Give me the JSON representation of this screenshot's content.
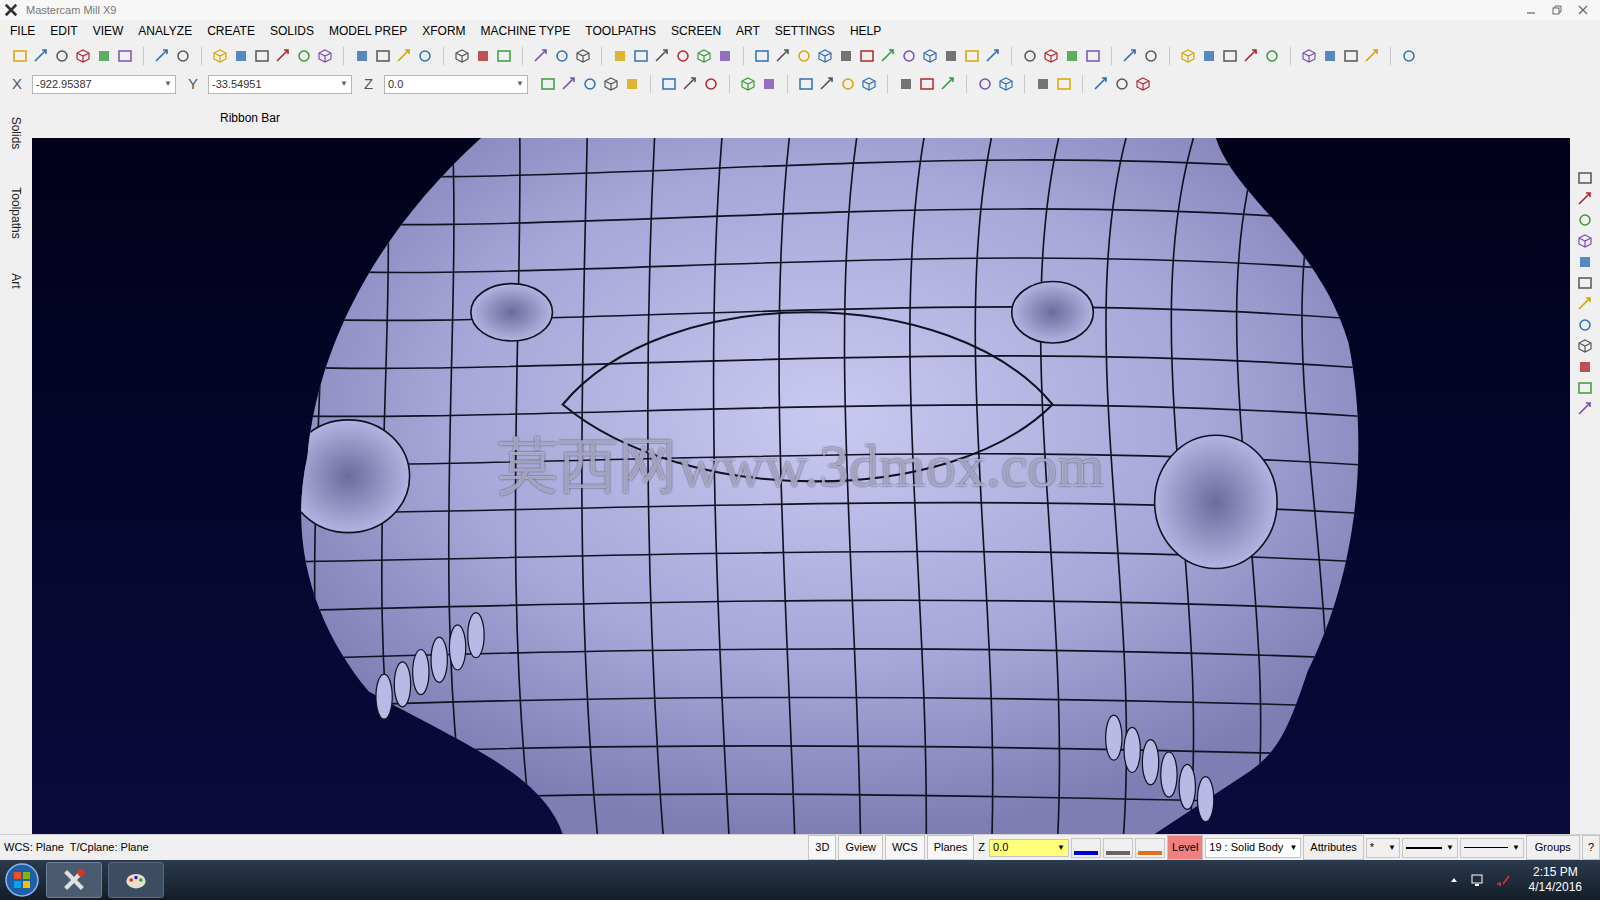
{
  "window": {
    "title": "Mastercam Mill X9"
  },
  "menu": [
    {
      "label": "FILE"
    },
    {
      "label": "EDIT"
    },
    {
      "label": "VIEW"
    },
    {
      "label": "ANALYZE"
    },
    {
      "label": "CREATE"
    },
    {
      "label": "SOLIDS"
    },
    {
      "label": "MODEL PREP"
    },
    {
      "label": "XFORM"
    },
    {
      "label": "MACHINE TYPE"
    },
    {
      "label": "TOOLPATHS"
    },
    {
      "label": "SCREEN"
    },
    {
      "label": "ART"
    },
    {
      "label": "SETTINGS"
    },
    {
      "label": "HELP"
    }
  ],
  "coordinates": [
    {
      "label": "X",
      "value": "-922.95387"
    },
    {
      "label": "Y",
      "value": "-33.54951"
    },
    {
      "label": "Z",
      "value": "0.0"
    }
  ],
  "ribbon": {
    "label": "Ribbon Bar"
  },
  "side_tabs": [
    {
      "label": "Solids"
    },
    {
      "label": "Toolpaths"
    },
    {
      "label": "Art"
    }
  ],
  "viewport": {
    "watermark": "莫西网www.3dmox.com"
  },
  "status_bar": {
    "info": "WCS: Plane  T/Cplane: Plane",
    "buttons": [
      "3D",
      "Gview",
      "WCS",
      "Planes"
    ],
    "z_label": "Z",
    "z_value": "0.0",
    "level_label": "Level",
    "level_value": "19 : Solid Body",
    "attributes": "Attributes",
    "point_style": "*",
    "groups": "Groups",
    "help": "?"
  },
  "taskbar": {
    "time": "2:15 PM",
    "date": "4/14/2016"
  }
}
